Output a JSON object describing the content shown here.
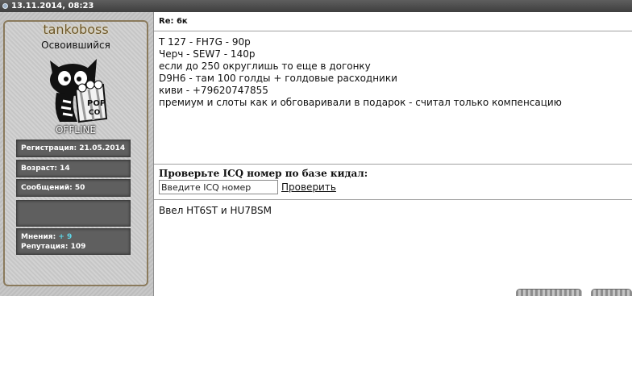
{
  "header": {
    "datetime": "13.11.2014, 08:23"
  },
  "author": {
    "username": "tankoboss",
    "rank": "Освоившийся",
    "status": "OFFLINE",
    "registration": "Регистрация: 21.05.2014",
    "age": "Возраст: 14",
    "messages": "Сообщений: 50",
    "opinions_label": "Мнения:",
    "opinions_value": "+ 9",
    "reputation_label": "Репутация:",
    "reputation_value": "109"
  },
  "post": {
    "title": "Re: 6к",
    "lines": [
      "Т 127 - FH7G - 90р",
      "Черч - SEW7 - 140р",
      "если до 250 округлишь то еще в догонку",
      "D9H6 - там 100 голды + голдовые расходники",
      "киви - +79620747855",
      "премиум и слоты как и обговаривали в подарок - считал только компенсацию"
    ]
  },
  "icq_check": {
    "title": "Проверьте ICQ номер по базе кидал:",
    "input_value": "Введите ICQ номер",
    "button_label": "Проверить"
  },
  "signature": "Ввел HT6ST и HU7BSM",
  "colors": {
    "username": "#6b5528",
    "opinions_accent": "#5fd7e8"
  },
  "icons": {
    "avatar": "cat-with-popcorn-icon",
    "header_dot": "status-dot-icon"
  }
}
